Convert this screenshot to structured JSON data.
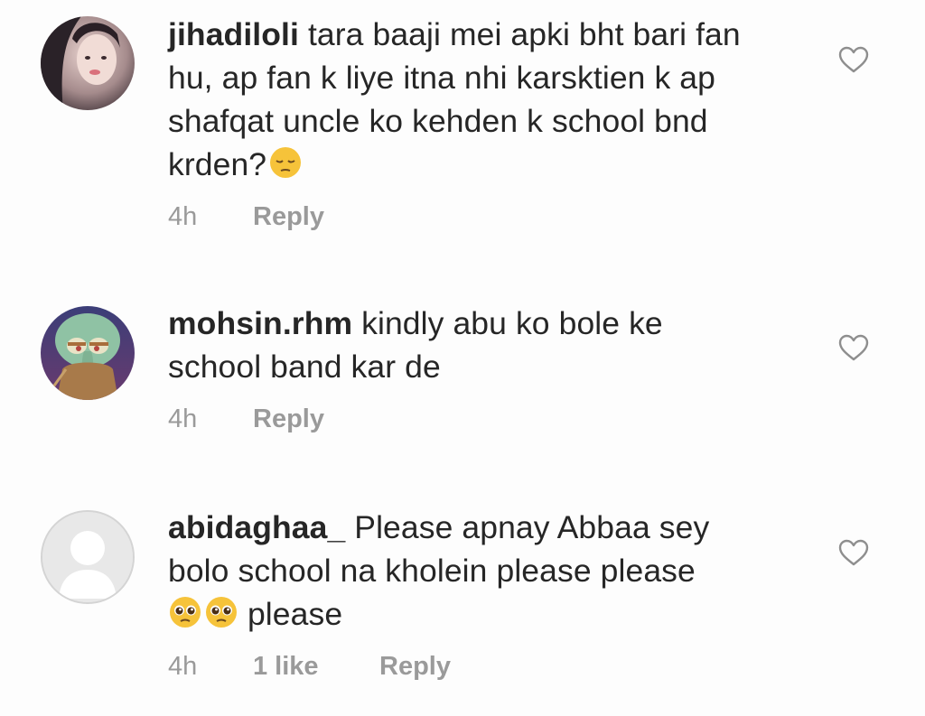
{
  "comments": [
    {
      "username": "jihadiloli",
      "lines": [
        "tara baaji mei apki bht bari fan",
        "hu, ap fan k liye itna nhi karsktien k ap",
        "shafqat uncle ko kehden k school bnd",
        "krden?"
      ],
      "time": "4h",
      "reply": "Reply",
      "avatar": "user-photo-avatar",
      "emoji": "pensive-face-emoji"
    },
    {
      "username": "mohsin.rhm",
      "lines": [
        "kindly abu ko bole ke",
        "school band kar de"
      ],
      "time": "4h",
      "reply": "Reply",
      "avatar": "squidward-cartoon-avatar"
    },
    {
      "username": "abidaghaa_",
      "lines": [
        "Please apnay Abbaa sey",
        "bolo school na kholein please please",
        "please"
      ],
      "time": "4h",
      "likes": "1 like",
      "reply": "Reply",
      "avatar": "default-profile-avatar",
      "emoji": "pleading-face-emoji"
    }
  ],
  "colors": {
    "text": "#262626",
    "meta": "#9a9a9a",
    "heart": "#8e8e8e",
    "emoji": "#f6c33a"
  }
}
